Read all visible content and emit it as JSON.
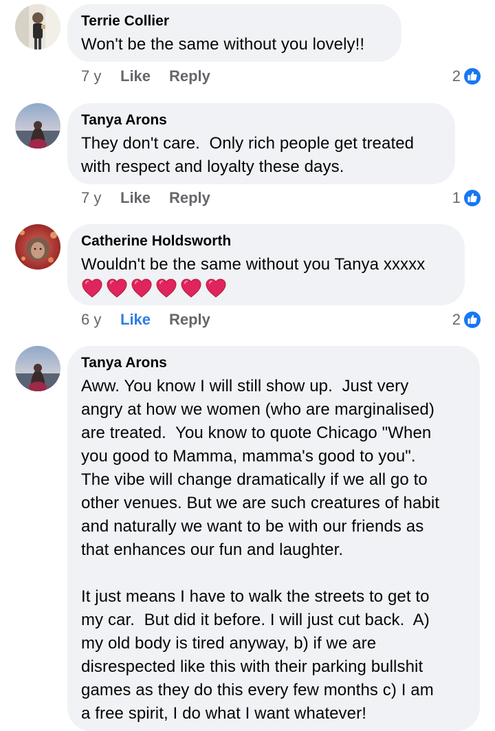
{
  "accent_color": "#1877f2",
  "comments": [
    {
      "author": "Terrie Collier",
      "text": "Won't be the same without you lovely!!",
      "age": "7 y",
      "like_label": "Like",
      "reply_label": "Reply",
      "reaction_count": "2",
      "liked": false
    },
    {
      "author": "Tanya Arons",
      "text": "They don't care.  Only rich people get treated\nwith respect and loyalty these days.",
      "age": "7 y",
      "like_label": "Like",
      "reply_label": "Reply",
      "reaction_count": "1",
      "liked": false
    },
    {
      "author": "Catherine Holdsworth",
      "text": "Wouldn't be the same without you Tanya xxxxx",
      "emoji": [
        "red-heart",
        "red-heart",
        "red-heart",
        "red-heart",
        "red-heart",
        "red-heart"
      ],
      "age": "6 y",
      "like_label": "Like",
      "reply_label": "Reply",
      "reaction_count": "2",
      "liked": true
    },
    {
      "author": "Tanya Arons",
      "text": "Aww. You know I will still show up.  Just very\nangry at how we women (who are marginalised)\nare treated.  You know to quote Chicago \"When\nyou good to Mamma, mamma's good to you\".\nThe vibe will change dramatically if we all go to\nother venues. But we are such creatures of habit\nand naturally we want to be with our friends as\nthat enhances our fun and laughter.\n\nIt just means I have to walk the streets to get to\nmy car.  But did it before. I will just cut back.  A)\nmy old body is tired anyway, b) if we are\ndisrespected like this with their parking bullshit\ngames as they do this every few months c) I am\na free spirit, I do what I want whatever!"
    }
  ]
}
